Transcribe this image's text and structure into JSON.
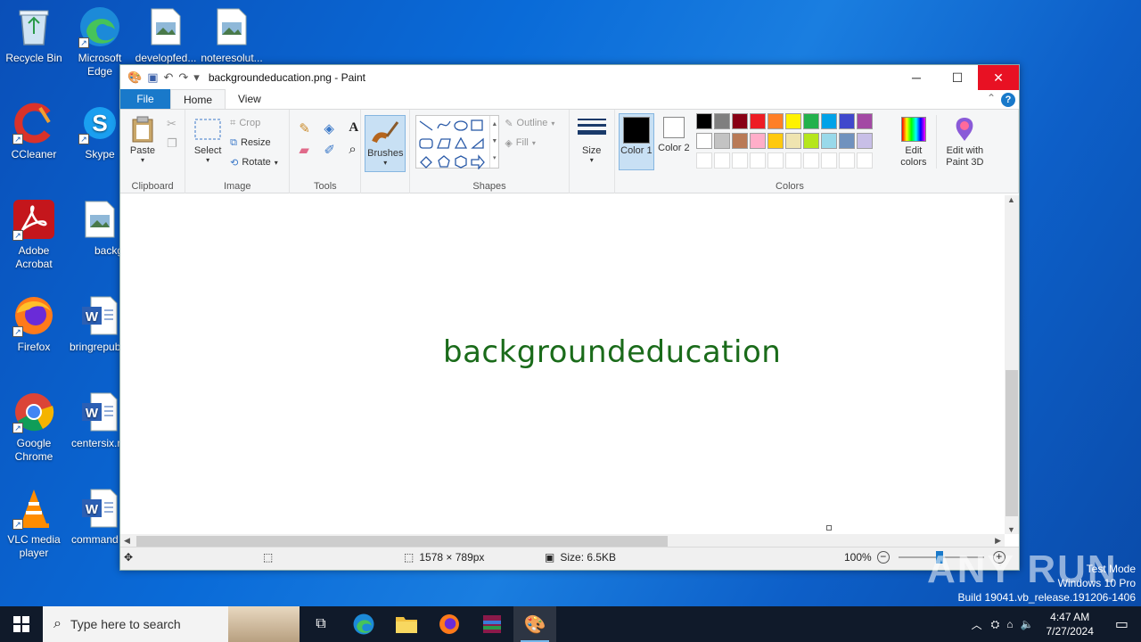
{
  "desktop": {
    "icons": [
      {
        "label": "Recycle Bin",
        "icon": "recycle-bin-icon"
      },
      {
        "label": "Microsoft Edge",
        "icon": "edge-icon"
      },
      {
        "label": "developfed...",
        "icon": "image-file-icon"
      },
      {
        "label": "noteresolut...",
        "icon": "image-file-icon"
      },
      {
        "label": "CCleaner",
        "icon": "ccleaner-icon"
      },
      {
        "label": "Skype",
        "icon": "skype-icon"
      },
      {
        "label": "Adobe Acrobat",
        "icon": "acrobat-icon"
      },
      {
        "label": "backgroun",
        "icon": "image-file-icon"
      },
      {
        "label": "Firefox",
        "icon": "firefox-icon"
      },
      {
        "label": "bringrepub",
        "icon": "word-doc-icon"
      },
      {
        "label": "Google Chrome",
        "icon": "chrome-icon"
      },
      {
        "label": "centersix.r",
        "icon": "word-doc-icon"
      },
      {
        "label": "VLC media player",
        "icon": "vlc-icon"
      },
      {
        "label": "command",
        "icon": "word-doc-icon"
      }
    ]
  },
  "window": {
    "title": "backgroundeducation.png - Paint",
    "tabs": {
      "file": "File",
      "home": "Home",
      "view": "View"
    },
    "help": "?"
  },
  "ribbon": {
    "clipboard": {
      "paste": "Paste",
      "label": "Clipboard"
    },
    "image": {
      "select": "Select",
      "crop": "Crop",
      "resize": "Resize",
      "rotate": "Rotate",
      "label": "Image"
    },
    "tools": {
      "label": "Tools"
    },
    "brushes": {
      "label": "Brushes"
    },
    "shapes": {
      "outline": "Outline",
      "fill": "Fill",
      "label": "Shapes"
    },
    "size": {
      "label": "Size"
    },
    "colors": {
      "color1": "Color 1",
      "color2": "Color 2",
      "edit_colors": "Edit colors",
      "edit_paint3d": "Edit with Paint 3D",
      "label": "Colors",
      "palette_row1": [
        "#000000",
        "#7f7f7f",
        "#880015",
        "#ed1c24",
        "#ff7f27",
        "#fff200",
        "#22b14c",
        "#00a2e8",
        "#3f48cc",
        "#a349a4"
      ],
      "palette_row2": [
        "#ffffff",
        "#c3c3c3",
        "#b97a57",
        "#ffaec9",
        "#ffc90e",
        "#efe4b0",
        "#b5e61d",
        "#99d9ea",
        "#7092be",
        "#c8bfe7"
      ],
      "color1_value": "#000000",
      "color2_value": "#ffffff"
    }
  },
  "canvas": {
    "text": "backgroundeducation",
    "text_color": "#1a6b1a"
  },
  "status": {
    "dimensions": "1578 × 789px",
    "size": "Size: 6.5KB",
    "zoom": "100%"
  },
  "taskbar": {
    "search_placeholder": "Type here to search",
    "time": "4:47 AM",
    "date": "7/27/2024"
  },
  "watermark": {
    "line1": "Test Mode",
    "line2": "Windows 10 Pro",
    "line3": "Build 19041.vb_release.191206-1406",
    "brand": "ANY RUN"
  }
}
